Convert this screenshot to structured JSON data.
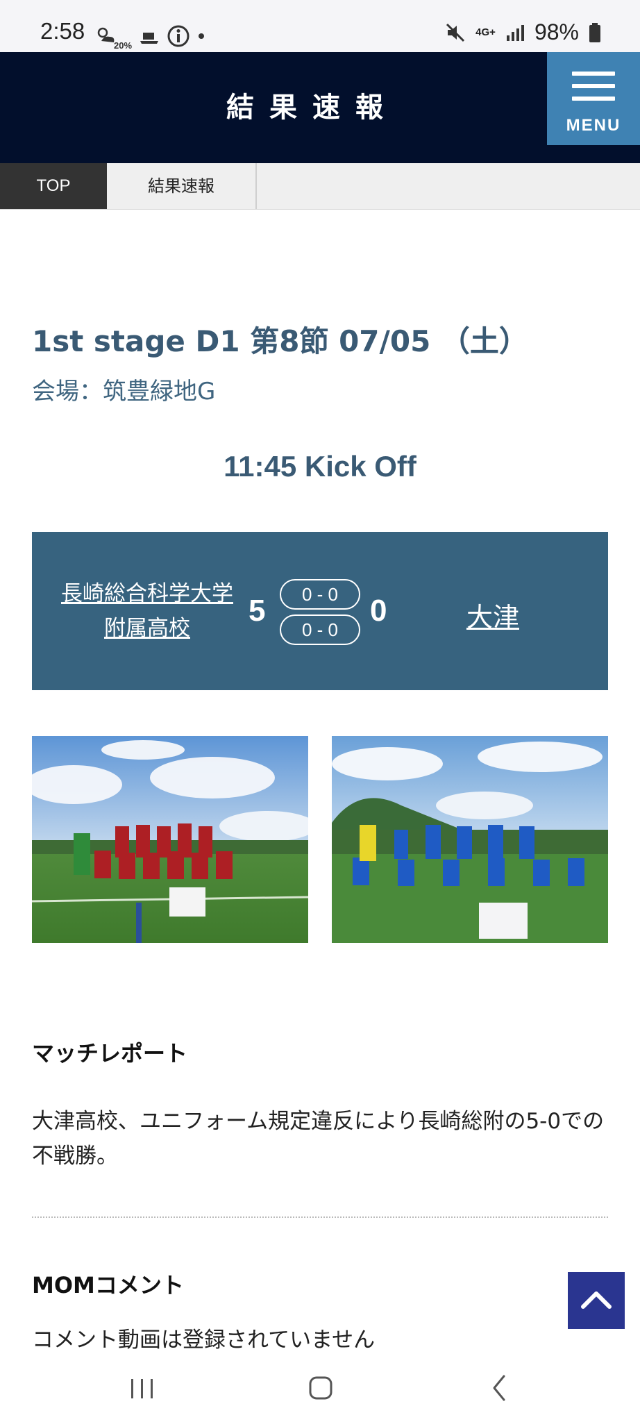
{
  "status": {
    "time": "2:58",
    "small_badge": "20%",
    "battery": "98%",
    "network": "4G+"
  },
  "header": {
    "title": "結果速報",
    "menu_label": "MENU"
  },
  "breadcrumb": {
    "top": "TOP",
    "current": "結果速報"
  },
  "match": {
    "stage": "1st stage D1 第8節 07/05 （土）",
    "venue": "会場：筑豊緑地G",
    "kickoff": "11:45 Kick Off",
    "home_team_line1": "長崎総合科学大学",
    "home_team_line2": "附属高校",
    "home_score": "5",
    "away_score": "0",
    "first_half": "0 - 0",
    "second_half": "0 - 0",
    "away_team": "大津"
  },
  "report": {
    "heading": "マッチレポート",
    "body": "大津高校、ユニフォーム規定違反により長崎総附の5-0での不戦勝。"
  },
  "mom": {
    "heading": "MOMコメント",
    "body": "コメント動画は登録されていません"
  },
  "colors": {
    "header_bg": "#020f2c",
    "menu_bg": "#3f82b3",
    "score_box": "#37637f",
    "accent_text": "#3a5a74",
    "scroll_top": "#2a3590"
  },
  "icons": [
    "mute-icon",
    "signal-icon",
    "battery-icon",
    "info-icon",
    "hamburger-icon",
    "chevron-up-icon",
    "recent-apps-icon",
    "home-icon",
    "back-icon"
  ]
}
